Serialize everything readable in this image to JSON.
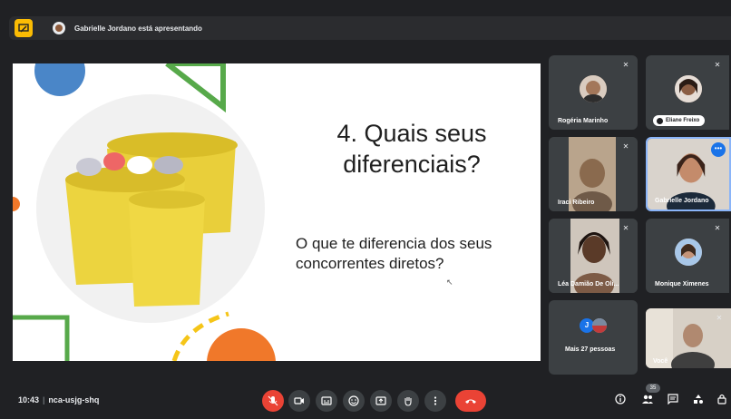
{
  "presenting": {
    "text": "Gabrielle Jordano está apresentando"
  },
  "slide": {
    "title": "4. Quais seus diferenciais?",
    "subtitle": "O que te diferencia dos seus concorrentes diretos?"
  },
  "participants": [
    {
      "name": "Rogéria Marinho"
    },
    {
      "name": "Eliane Freixo"
    },
    {
      "name": "Iraci Ribeiro"
    },
    {
      "name": "Gabrielle Jordano"
    },
    {
      "name": "Léa Damião De Oli..."
    },
    {
      "name": "Monique Ximenes"
    },
    {
      "name": "Mais 27 pessoas",
      "avatar_letter": "J"
    },
    {
      "name": "Você"
    }
  ],
  "bottom": {
    "time": "10:43",
    "meeting_code": "nca-usjg-shq",
    "participant_count": "35"
  },
  "colors": {
    "accent": "#1a73e8",
    "danger": "#ea4335",
    "present": "#fbbc04"
  },
  "icons": [
    "present-icon",
    "mic-off-icon",
    "camera-icon",
    "captions-icon",
    "emoji-icon",
    "present-screen-icon",
    "raise-hand-icon",
    "more-options-icon",
    "end-call-icon",
    "info-icon",
    "people-icon",
    "chat-icon",
    "activities-icon",
    "host-controls-icon"
  ]
}
